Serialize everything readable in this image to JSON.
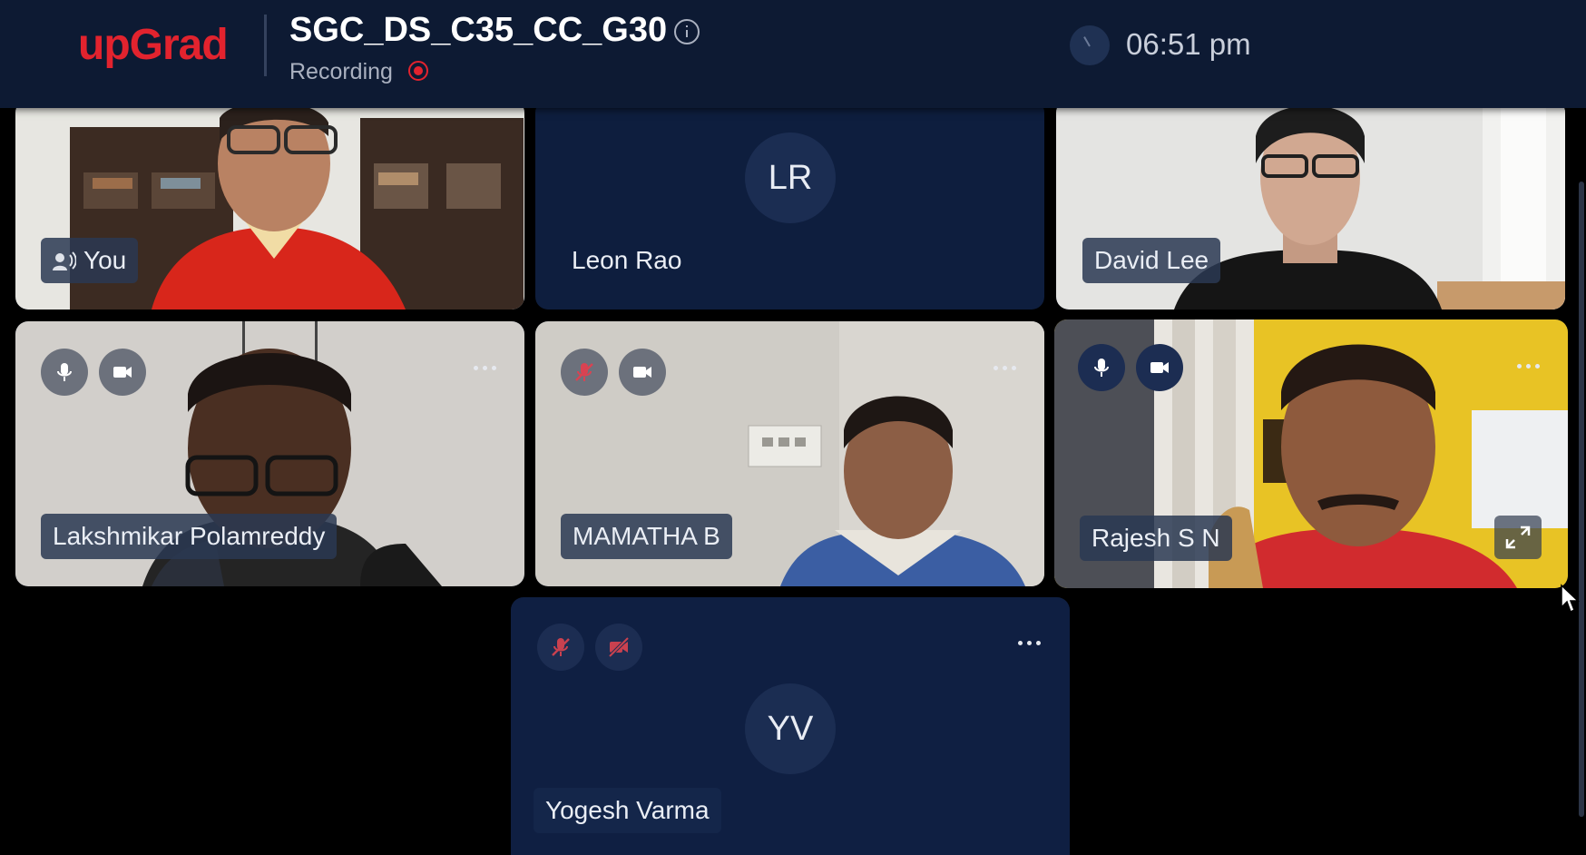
{
  "header": {
    "logo": "upGrad",
    "meeting_title": "SGC_DS_C35_CC_G30",
    "recording_label": "Recording",
    "time": "06:51 pm"
  },
  "participants": [
    {
      "id": "you",
      "name": "You",
      "has_video": true,
      "speaking": true
    },
    {
      "id": "leon",
      "name": "Leon Rao",
      "initials": "LR",
      "has_video": false
    },
    {
      "id": "david",
      "name": "David Lee",
      "has_video": true
    },
    {
      "id": "lakshmikar",
      "name": "Lakshmikar Polamreddy",
      "has_video": true,
      "mic": "on",
      "camera": "on"
    },
    {
      "id": "mamatha",
      "name": "MAMATHA B",
      "has_video": true,
      "mic": "muted",
      "camera": "on"
    },
    {
      "id": "rajesh",
      "name": "Rajesh S N",
      "has_video": true,
      "mic": "on",
      "camera": "on"
    },
    {
      "id": "yogesh",
      "name": "Yogesh Varma",
      "initials": "YV",
      "has_video": false,
      "mic": "muted",
      "camera": "off"
    }
  ],
  "colors": {
    "brand": "#e2232e",
    "header_bg": "#0d1a33",
    "tile_bg": "#0d1e3d",
    "muted_icon": "#d94352"
  },
  "icons": [
    "info-icon",
    "recording-icon",
    "clock-icon",
    "microphone-icon",
    "microphone-muted-icon",
    "camera-icon",
    "camera-off-icon",
    "more-options-icon",
    "expand-icon",
    "speaker-icon"
  ]
}
